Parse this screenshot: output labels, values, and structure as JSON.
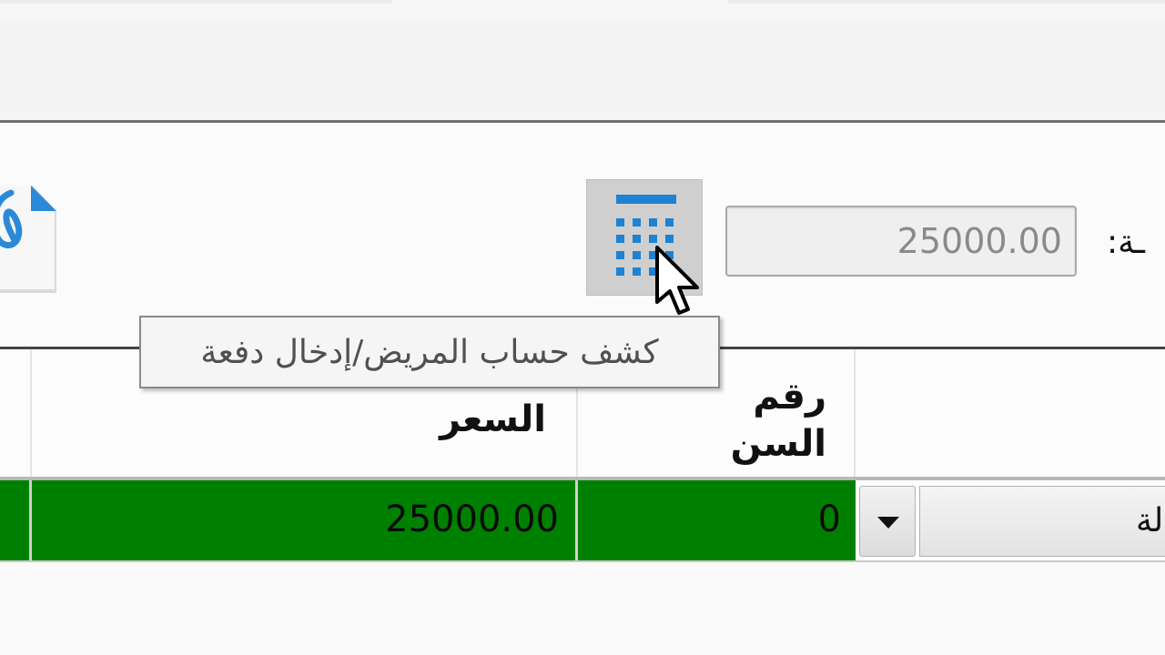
{
  "form": {
    "amount_label": "ـة:",
    "amount_value": "25000.00",
    "calculator_button_tooltip": "كشف حساب المريض/إدخال دفعة"
  },
  "table": {
    "columns": {
      "price": "السعر",
      "tooth_number": "رقم السن"
    },
    "rows": [
      {
        "price": "25000.00",
        "tooth_number": "0",
        "dropdown_value": "لة"
      }
    ]
  },
  "icons": [
    "calculator-icon",
    "attachment-icon",
    "mouse-cursor-icon",
    "chevron-down-icon"
  ],
  "colors": {
    "selected_row": "#008000",
    "calculator_icon": "#1e82d2"
  }
}
